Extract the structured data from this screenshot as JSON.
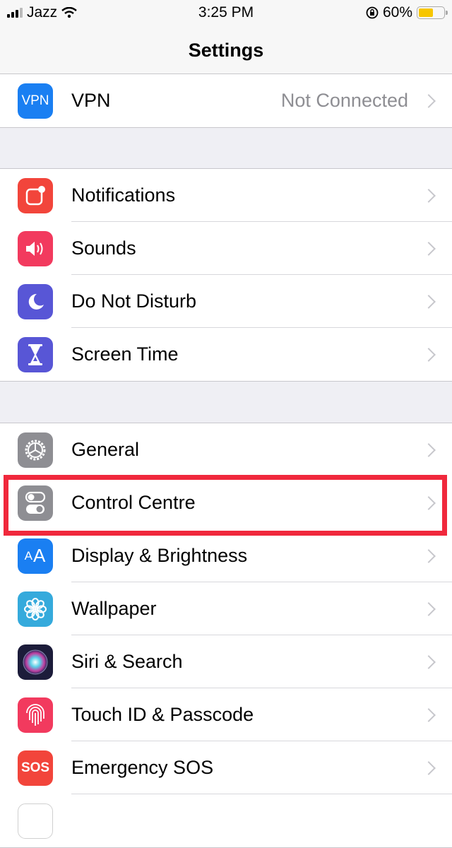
{
  "status_bar": {
    "carrier": "Jazz",
    "time": "3:25 PM",
    "battery_percent_label": "60%",
    "battery_level": 0.6,
    "icons": [
      "signal-icon",
      "wifi-icon",
      "orientation-lock-icon",
      "battery-icon"
    ]
  },
  "nav": {
    "title": "Settings"
  },
  "groups": [
    {
      "items": [
        {
          "label": "VPN",
          "value": "Not Connected",
          "icon": "vpn-icon",
          "color": "#1a7ff2"
        }
      ]
    },
    {
      "items": [
        {
          "label": "Notifications",
          "icon": "notifications-icon",
          "color": "#f2453b"
        },
        {
          "label": "Sounds",
          "icon": "speaker-icon",
          "color": "#f23a5e"
        },
        {
          "label": "Do Not Disturb",
          "icon": "moon-icon",
          "color": "#5856d6"
        },
        {
          "label": "Screen Time",
          "icon": "hourglass-icon",
          "color": "#5856d6"
        }
      ]
    },
    {
      "items": [
        {
          "label": "General",
          "icon": "gear-icon",
          "color": "#8e8e93"
        },
        {
          "label": "Control Centre",
          "icon": "toggles-icon",
          "color": "#8e8e93",
          "highlighted": true
        },
        {
          "label": "Display & Brightness",
          "icon": "text-size-icon",
          "color": "#1a7ff2"
        },
        {
          "label": "Wallpaper",
          "icon": "flower-icon",
          "color": "#35aadc"
        },
        {
          "label": "Siri & Search",
          "icon": "siri-icon",
          "color": "#1c1c3a"
        },
        {
          "label": "Touch ID & Passcode",
          "icon": "fingerprint-icon",
          "color": "#f23a5e"
        },
        {
          "label": "Emergency SOS",
          "icon": "sos-icon",
          "color": "#f2453b"
        }
      ]
    }
  ],
  "icon_text": {
    "vpn": "VPN",
    "text_size": "AA",
    "sos": "SOS"
  },
  "highlight_color": "#f0283c"
}
